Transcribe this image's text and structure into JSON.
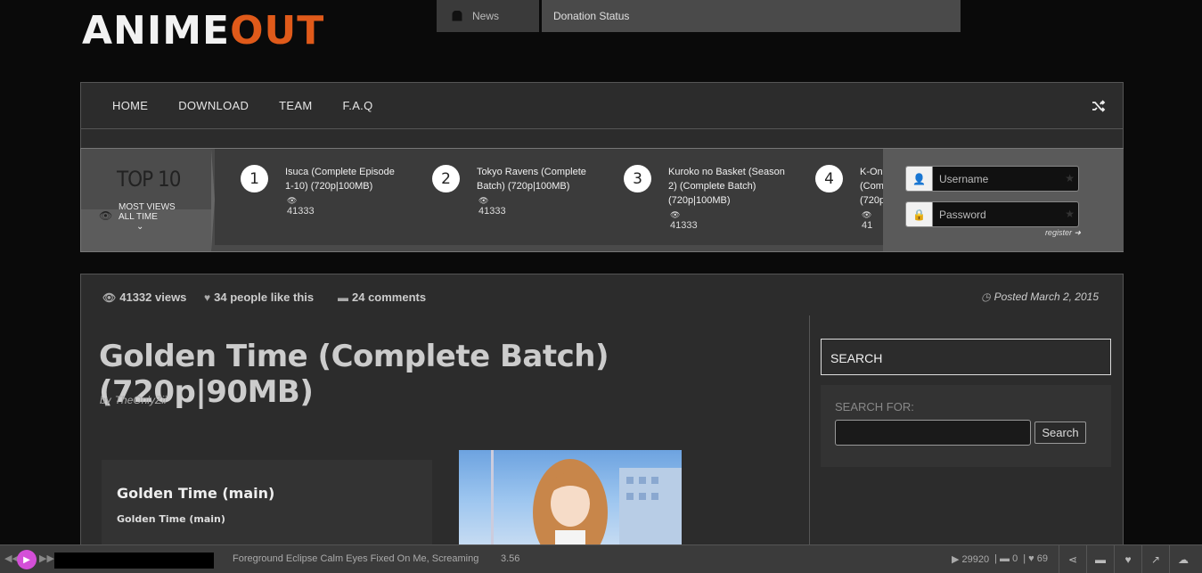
{
  "logo": {
    "part1": "ANIME",
    "part2": "OUT"
  },
  "topnav": {
    "news": "News",
    "donation": "Donation Status"
  },
  "menu": {
    "items": [
      "HOME",
      "DOWNLOAD",
      "TEAM",
      "F.A.Q"
    ]
  },
  "top10": {
    "label": "TOP 10",
    "filter": "MOST VIEWS",
    "period": "ALL TIME",
    "items": [
      {
        "rank": "1",
        "title": "Isuca (Complete Episode 1-10) (720p|100MB)",
        "views": "41333"
      },
      {
        "rank": "2",
        "title": "Tokyo Ravens (Complete Batch) (720p|100MB)",
        "views": "41333"
      },
      {
        "rank": "3",
        "title": "Kuroko no Basket (Season 2) (Complete Batch) (720p|100MB)",
        "views": "41333"
      },
      {
        "rank": "4",
        "title": "K-On! (Comp (720p",
        "views": "41"
      }
    ]
  },
  "login": {
    "username_placeholder": "Username",
    "password_placeholder": "Password",
    "register": "register"
  },
  "post": {
    "views": "41332 views",
    "likes": "34 people like this",
    "comments": "24 comments",
    "posted": "Posted March 2, 2015",
    "title": "Golden Time (Complete Batch) (720p|90MB)",
    "by_label": "by",
    "author": "TheOnlyZii",
    "box_heading": "Golden Time (main)",
    "box_sub": "Golden Time (main)"
  },
  "sidebar": {
    "search_title": "SEARCH",
    "search_for": "SEARCH FOR:",
    "search_button": "Search"
  },
  "player": {
    "track": "Foreground Eclipse Calm Eyes Fixed On Me, Screaming",
    "duration": "3.56",
    "plays": "29920",
    "comments": "0",
    "likes": "69"
  },
  "colors": {
    "accent_logo": "#e05a1a",
    "play_button": "#d44fd8"
  }
}
